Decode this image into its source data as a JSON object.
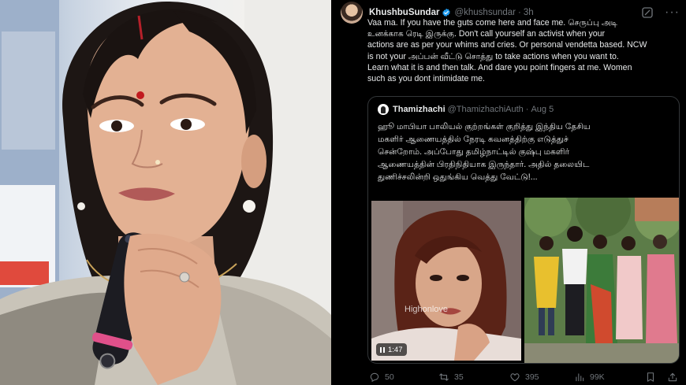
{
  "tweet": {
    "name": "KhushbuSundar",
    "handle": "@khushsundar",
    "dot": "·",
    "time": "3h",
    "more": "···",
    "text": "Vaa ma. If you have the guts come here and face me. செருப்பு அடி\nஉனக்காக ரெடி இருக்கு.  Don't call yourself an activist when your\nactions are as per your whims and cries. Or personal vendetta based. NCW\nis not your அப்பன் வீட்டு சொத்து to take actions when you want to.\nLearn what it is and then talk. And dare you point fingers at me. Women\nsuch as you dont intimidate me."
  },
  "quote": {
    "name": "Thamizhachi",
    "handle": "@ThamizhachiAuth",
    "dot": "·",
    "date": "Aug 5",
    "text": "ஹூ மாபியா பாலியல் குற்றங்கள் குறித்து இந்திய தேசிய\nமகளிர் ஆணையத்தில் நேரடி கவனத்திற்கு எடுத்துச்\nசென்றோம். அப்போது தமிழ்நாட்டில் குஷ்பு மகளிர்\nஆணையத்தின் பிரதிநிதியாக இருந்தார். அதில் தலையிட\nதுணிச்சலின்றி ஒதுங்கிய வெத்து வேட்டு!...",
    "video_watermark": "Highonlove",
    "video_duration": "1:47"
  },
  "actions": {
    "replies": "50",
    "retweets": "35",
    "likes": "395",
    "views": "99K"
  },
  "colors": {
    "background": "#000000",
    "text": "#e7e9ea",
    "muted": "#71767b",
    "border": "#333639",
    "verified": "#1d9bf0"
  },
  "icons": [
    "verified-badge-icon",
    "grok-icon",
    "more-icon",
    "reply-icon",
    "retweet-icon",
    "like-icon",
    "views-icon",
    "bookmark-icon",
    "share-icon",
    "pause-icon"
  ]
}
